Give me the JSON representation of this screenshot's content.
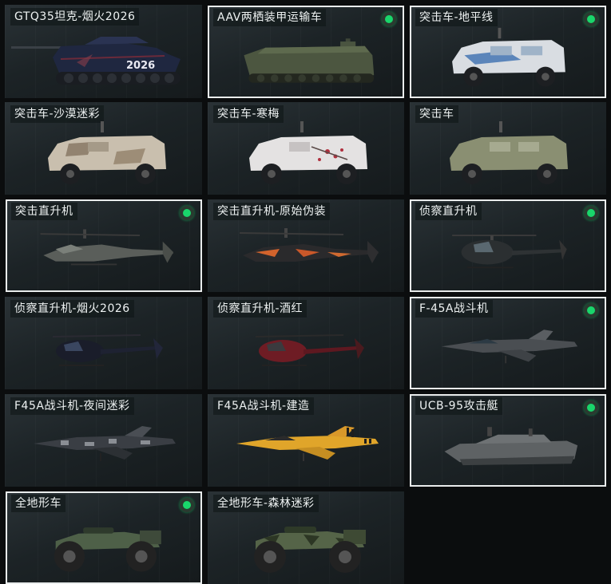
{
  "colors": {
    "accent": "#19d66b",
    "selected_border": "#e9ecec",
    "background": "#0b0d0e"
  },
  "vehicles": [
    {
      "label": "GTQ35坦克-烟火2026",
      "selected": false,
      "icon": "tank-icon",
      "decal": "2026"
    },
    {
      "label": "AAV两栖装甲运输车",
      "selected": true,
      "icon": "amphibious-vehicle-icon"
    },
    {
      "label": "突击车-地平线",
      "selected": true,
      "icon": "assault-vehicle-icon"
    },
    {
      "label": "突击车-沙漠迷彩",
      "selected": false,
      "icon": "assault-vehicle-icon"
    },
    {
      "label": "突击车-寒梅",
      "selected": false,
      "icon": "assault-vehicle-icon"
    },
    {
      "label": "突击车",
      "selected": false,
      "icon": "assault-vehicle-icon"
    },
    {
      "label": "突击直升机",
      "selected": true,
      "icon": "attack-helicopter-icon"
    },
    {
      "label": "突击直升机-原始伪装",
      "selected": false,
      "icon": "attack-helicopter-icon"
    },
    {
      "label": "侦察直升机",
      "selected": true,
      "icon": "scout-helicopter-icon"
    },
    {
      "label": "侦察直升机-烟火2026",
      "selected": false,
      "icon": "scout-helicopter-icon"
    },
    {
      "label": "侦察直升机-酒红",
      "selected": false,
      "icon": "scout-helicopter-icon"
    },
    {
      "label": "F-45A战斗机",
      "selected": true,
      "icon": "fighter-jet-icon"
    },
    {
      "label": "F45A战斗机-夜间迷彩",
      "selected": false,
      "icon": "fighter-jet-icon"
    },
    {
      "label": "F45A战斗机-建造",
      "selected": false,
      "icon": "fighter-jet-icon"
    },
    {
      "label": "UCB-95攻击艇",
      "selected": true,
      "icon": "attack-boat-icon"
    },
    {
      "label": "全地形车",
      "selected": true,
      "icon": "atv-icon"
    },
    {
      "label": "全地形车-森林迷彩",
      "selected": false,
      "icon": "atv-icon"
    }
  ]
}
